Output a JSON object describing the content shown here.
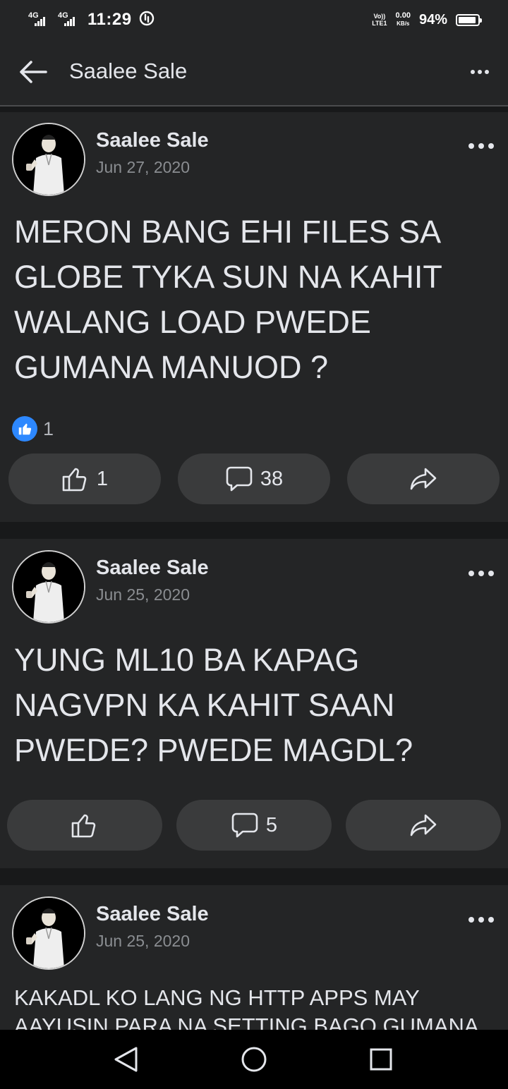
{
  "status_bar": {
    "network_1": "4G",
    "network_2": "4G",
    "time": "11:29",
    "volte_top": "Vo))",
    "volte_bottom": "LTE1",
    "speed_value": "0.00",
    "speed_unit": "KB/s",
    "battery_percent": "94%",
    "battery_level": 0.94
  },
  "header": {
    "title": "Saalee Sale",
    "back_icon": "arrow-left-icon",
    "more_icon": "more-horizontal-icon"
  },
  "posts": [
    {
      "author": "Saalee Sale",
      "date": "Jun 27, 2020",
      "text": "MERON BANG EHI FILES SA GLOBE TYKA SUN NA KAHIT WALANG LOAD PWEDE GUMANA MANUOD ?",
      "reaction_count": "1",
      "like_count": "1",
      "comment_count": "38"
    },
    {
      "author": "Saalee Sale",
      "date": "Jun 25, 2020",
      "text": "YUNG ML10 BA KAPAG NAGVPN KA KAHIT SAAN PWEDE? PWEDE MAGDL?",
      "comment_count": "5"
    },
    {
      "author": "Saalee Sale",
      "date": "Jun 25, 2020",
      "text": "KAKADL KO LANG NG HTTP APPS MAY AAYUSIN PARA NA SETTING BAGO GUMANA"
    }
  ],
  "colors": {
    "background": "#242526",
    "feed_gap": "#18191a",
    "button": "#3a3b3c",
    "like_blue": "#2d88ff",
    "secondary_text": "#8a8d91"
  }
}
